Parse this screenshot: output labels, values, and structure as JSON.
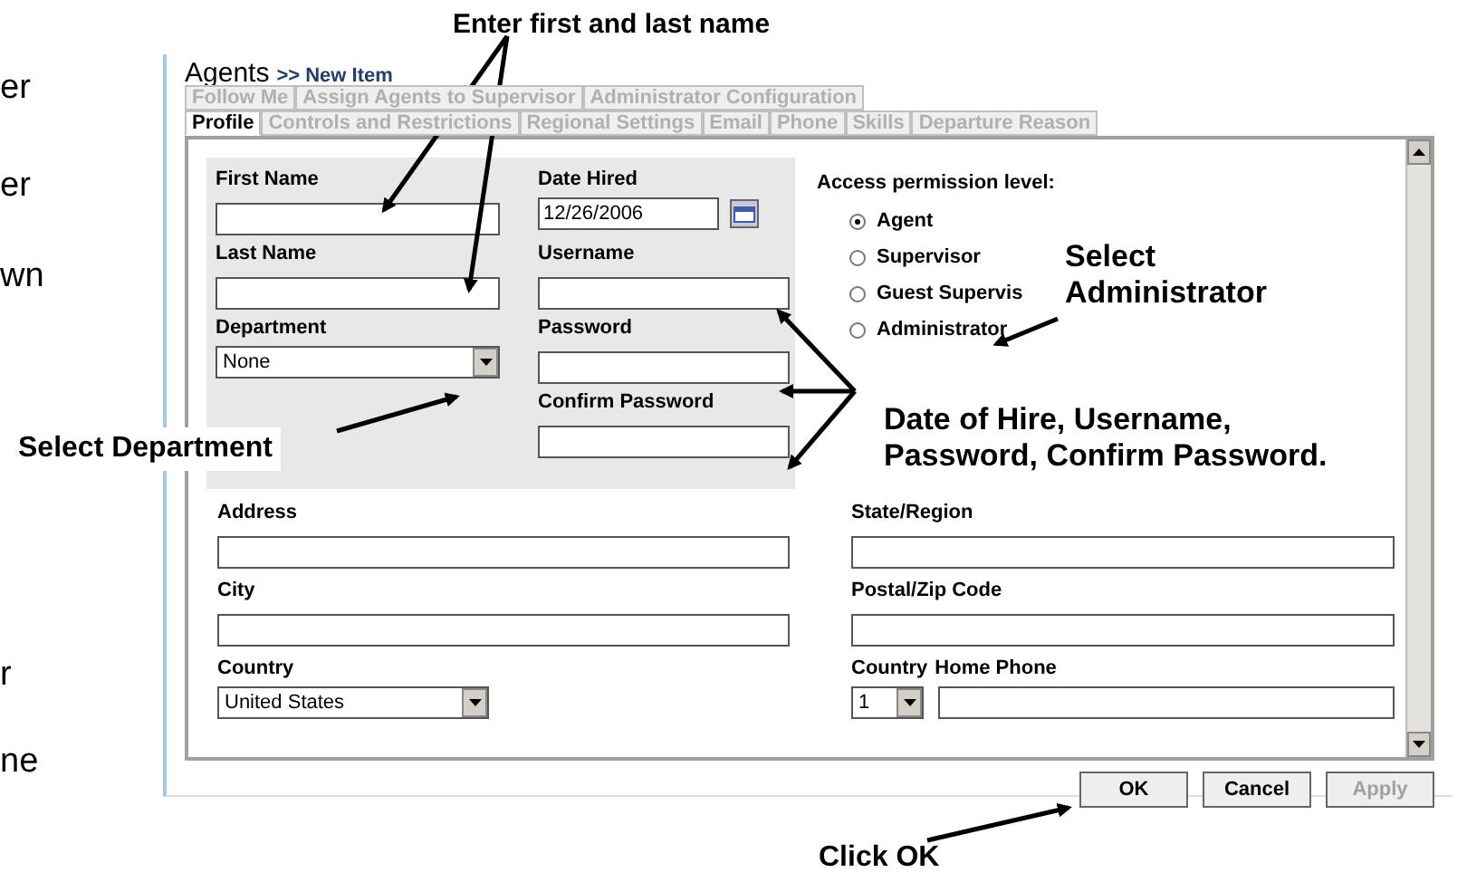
{
  "side_text": [
    "er",
    "er",
    "wn",
    "r",
    "ne"
  ],
  "header": {
    "title": "Agents",
    "breadcrumb": ">> New Item"
  },
  "tab_rows": [
    [
      {
        "label": "Follow Me",
        "selected": false
      },
      {
        "label": "Assign Agents to Supervisor",
        "selected": false
      },
      {
        "label": "Administrator Configuration",
        "selected": false
      }
    ],
    [
      {
        "label": "Profile",
        "selected": true
      },
      {
        "label": "Controls and Restrictions",
        "selected": false
      },
      {
        "label": "Regional Settings",
        "selected": false
      },
      {
        "label": "Email",
        "selected": false
      },
      {
        "label": "Phone",
        "selected": false
      },
      {
        "label": "Skills",
        "selected": false
      },
      {
        "label": "Departure Reason",
        "selected": false
      }
    ]
  ],
  "identity_fields": [
    {
      "label": "First Name",
      "kind": "text"
    },
    {
      "label": "Date Hired",
      "kind": "date",
      "value": "12/26/2006"
    },
    {
      "label": "Last Name",
      "kind": "text"
    },
    {
      "label": "Username",
      "kind": "text"
    },
    {
      "label": "Department",
      "kind": "select",
      "value": "None"
    },
    {
      "label": "Password",
      "kind": "text"
    },
    {
      "label": "Confirm Password",
      "kind": "text"
    }
  ],
  "access": {
    "title": "Access permission level:",
    "options": [
      {
        "label": "Agent",
        "selected": true
      },
      {
        "label": "Supervisor",
        "selected": false
      },
      {
        "label": "Guest Supervis",
        "selected": false
      },
      {
        "label": "Administrator",
        "selected": false
      }
    ]
  },
  "address_fields": [
    {
      "label": "Address",
      "kind": "text"
    },
    {
      "label": "State/Region",
      "kind": "text"
    },
    {
      "label": "City",
      "kind": "text"
    },
    {
      "label": "Postal/Zip Code",
      "kind": "text"
    },
    {
      "label": "Country",
      "kind": "select",
      "value": "United States"
    },
    {
      "label": "Country",
      "label2": "Home Phone",
      "kind": "phone",
      "value": "1"
    }
  ],
  "buttons": [
    {
      "label": "OK",
      "disabled": false
    },
    {
      "label": "Cancel",
      "disabled": false
    },
    {
      "label": "Apply",
      "disabled": true
    }
  ],
  "callouts": [
    "Enter first and last name",
    "Select Administrator",
    "Select Department",
    "Date of Hire, Username, Password, Confirm Password.",
    "Click OK"
  ]
}
